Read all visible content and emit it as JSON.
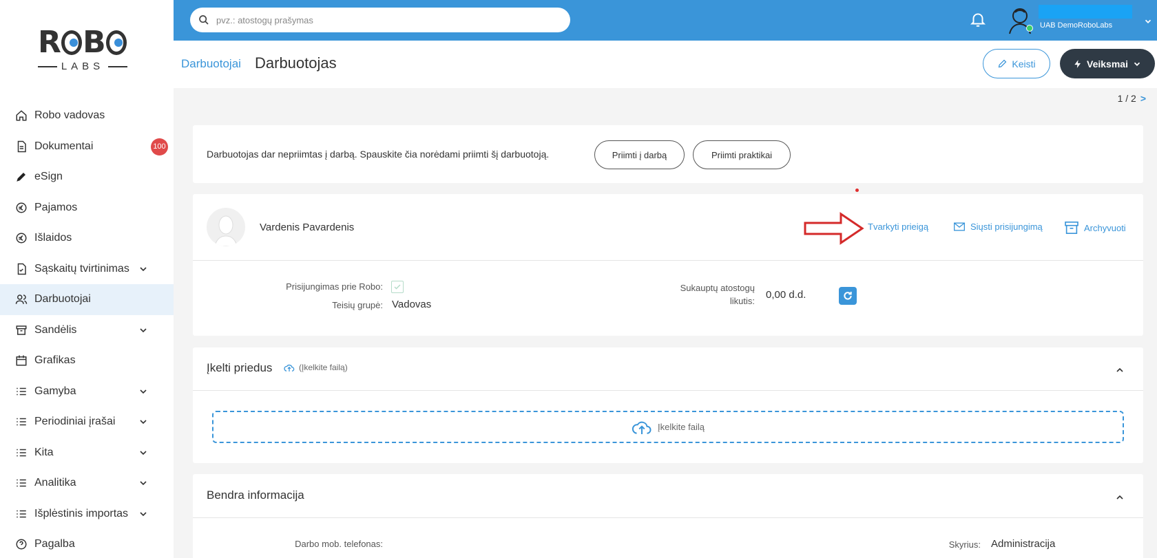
{
  "sidebar": {
    "logo_top": "ROBO",
    "logo_bottom": "LABS",
    "items": [
      {
        "label": "Robo vadovas",
        "icon": "home-icon"
      },
      {
        "label": "Dokumentai",
        "icon": "document-icon",
        "badge": "100"
      },
      {
        "label": "eSign",
        "icon": "pen-icon"
      },
      {
        "label": "Pajamos",
        "icon": "euro-circle-icon"
      },
      {
        "label": "Išlaidos",
        "icon": "euro-circle-icon"
      },
      {
        "label": "Sąskaitų tvirtinimas",
        "icon": "document-check-icon",
        "chevron": true
      },
      {
        "label": "Darbuotojai",
        "icon": "users-icon",
        "active": true
      },
      {
        "label": "Sandėlis",
        "icon": "archive-icon",
        "chevron": true
      },
      {
        "label": "Grafikas",
        "icon": "calendar-icon"
      },
      {
        "label": "Gamyba",
        "icon": "list-icon",
        "chevron": true
      },
      {
        "label": "Periodiniai įrašai",
        "icon": "list-icon",
        "chevron": true
      },
      {
        "label": "Kita",
        "icon": "list-icon",
        "chevron": true
      },
      {
        "label": "Analitika",
        "icon": "list-icon",
        "chevron": true
      },
      {
        "label": "Išplėstinis importas",
        "icon": "list-icon",
        "chevron": true
      },
      {
        "label": "Pagalba",
        "icon": "help-circle-icon"
      }
    ]
  },
  "topbar": {
    "search_placeholder": "pvz.: atostogų prašymas",
    "company": "UAB DemoRoboLabs",
    "accent": "#3a95d9"
  },
  "header": {
    "breadcrumb": "Darbuotojai",
    "title": "Darbuotojas",
    "edit_label": "Keisti",
    "actions_label": "Veiksmai"
  },
  "pager": {
    "text": "1 / 2",
    "next": ">"
  },
  "notice": {
    "text": "Darbuotojas dar nepriimtas į darbą. Spauskite čia norėdami priimti šį darbuotoją.",
    "hire_button": "Priimti į darbą",
    "intern_button": "Priimti praktikai"
  },
  "employee": {
    "name": "Vardenis Pavardenis",
    "manage_access": "Tvarkyti prieigą",
    "send_login": "Siųsti prisijungimą",
    "archive": "Archyvuoti",
    "login_label": "Prisijungimas prie Robo:",
    "rights_label": "Teisių grupė:",
    "rights_value": "Vadovas",
    "vacation_label_1": "Sukauptų atostogų",
    "vacation_label_2": "likutis:",
    "vacation_value": "0,00 d.d."
  },
  "attachments": {
    "title": "Įkelti priedus",
    "upload_link": "(Įkelkite failą)",
    "dropzone_label": "Įkelkite failą"
  },
  "general": {
    "title": "Bendra informacija",
    "phone_label": "Darbo mob. telefonas:",
    "department_label": "Skyrius:",
    "department_value": "Administracija"
  }
}
